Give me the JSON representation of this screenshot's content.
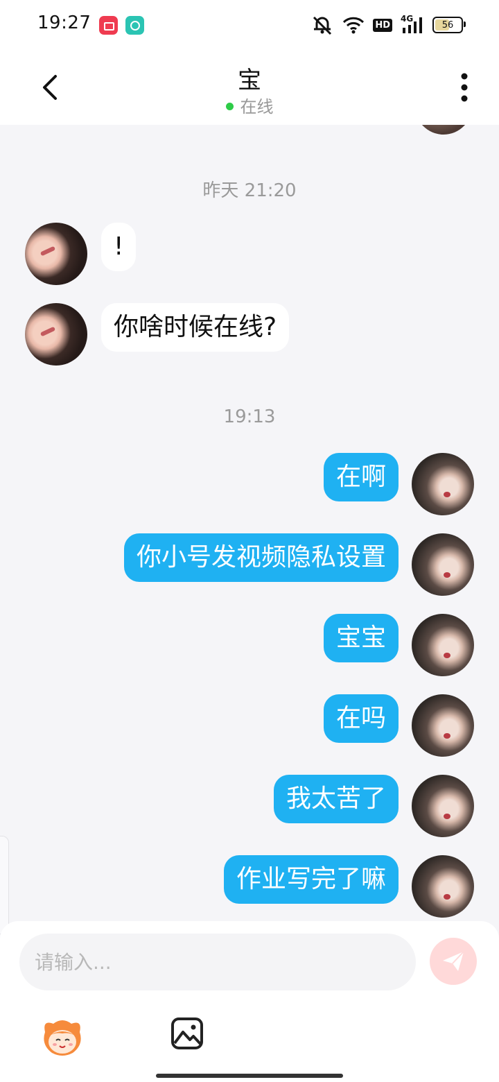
{
  "status_bar": {
    "time": "19:27",
    "app_icons": [
      "video-app-icon",
      "chat-app-icon"
    ],
    "network": "4G",
    "hd": "HD",
    "battery": "56",
    "battery_level": 0.56
  },
  "header": {
    "title": "宝",
    "status": "在线",
    "status_color": "#2ecc48"
  },
  "chat": {
    "timestamp_1": "昨天 21:20",
    "timestamp_2": "19:13",
    "messages": [
      {
        "side": "left",
        "text": "!"
      },
      {
        "side": "left",
        "text": "你啥时候在线?"
      },
      {
        "side": "right",
        "text": "在啊"
      },
      {
        "side": "right",
        "text": "你小号发视频隐私设置"
      },
      {
        "side": "right",
        "text": "宝宝"
      },
      {
        "side": "right",
        "text": "在吗"
      },
      {
        "side": "right",
        "text": "我太苦了"
      },
      {
        "side": "right",
        "text": "作业写完了嘛"
      }
    ],
    "outgoing_bubble_color": "#1fb1f2",
    "incoming_bubble_color": "#ffffff"
  },
  "composer": {
    "placeholder": "请输入...",
    "value": ""
  }
}
